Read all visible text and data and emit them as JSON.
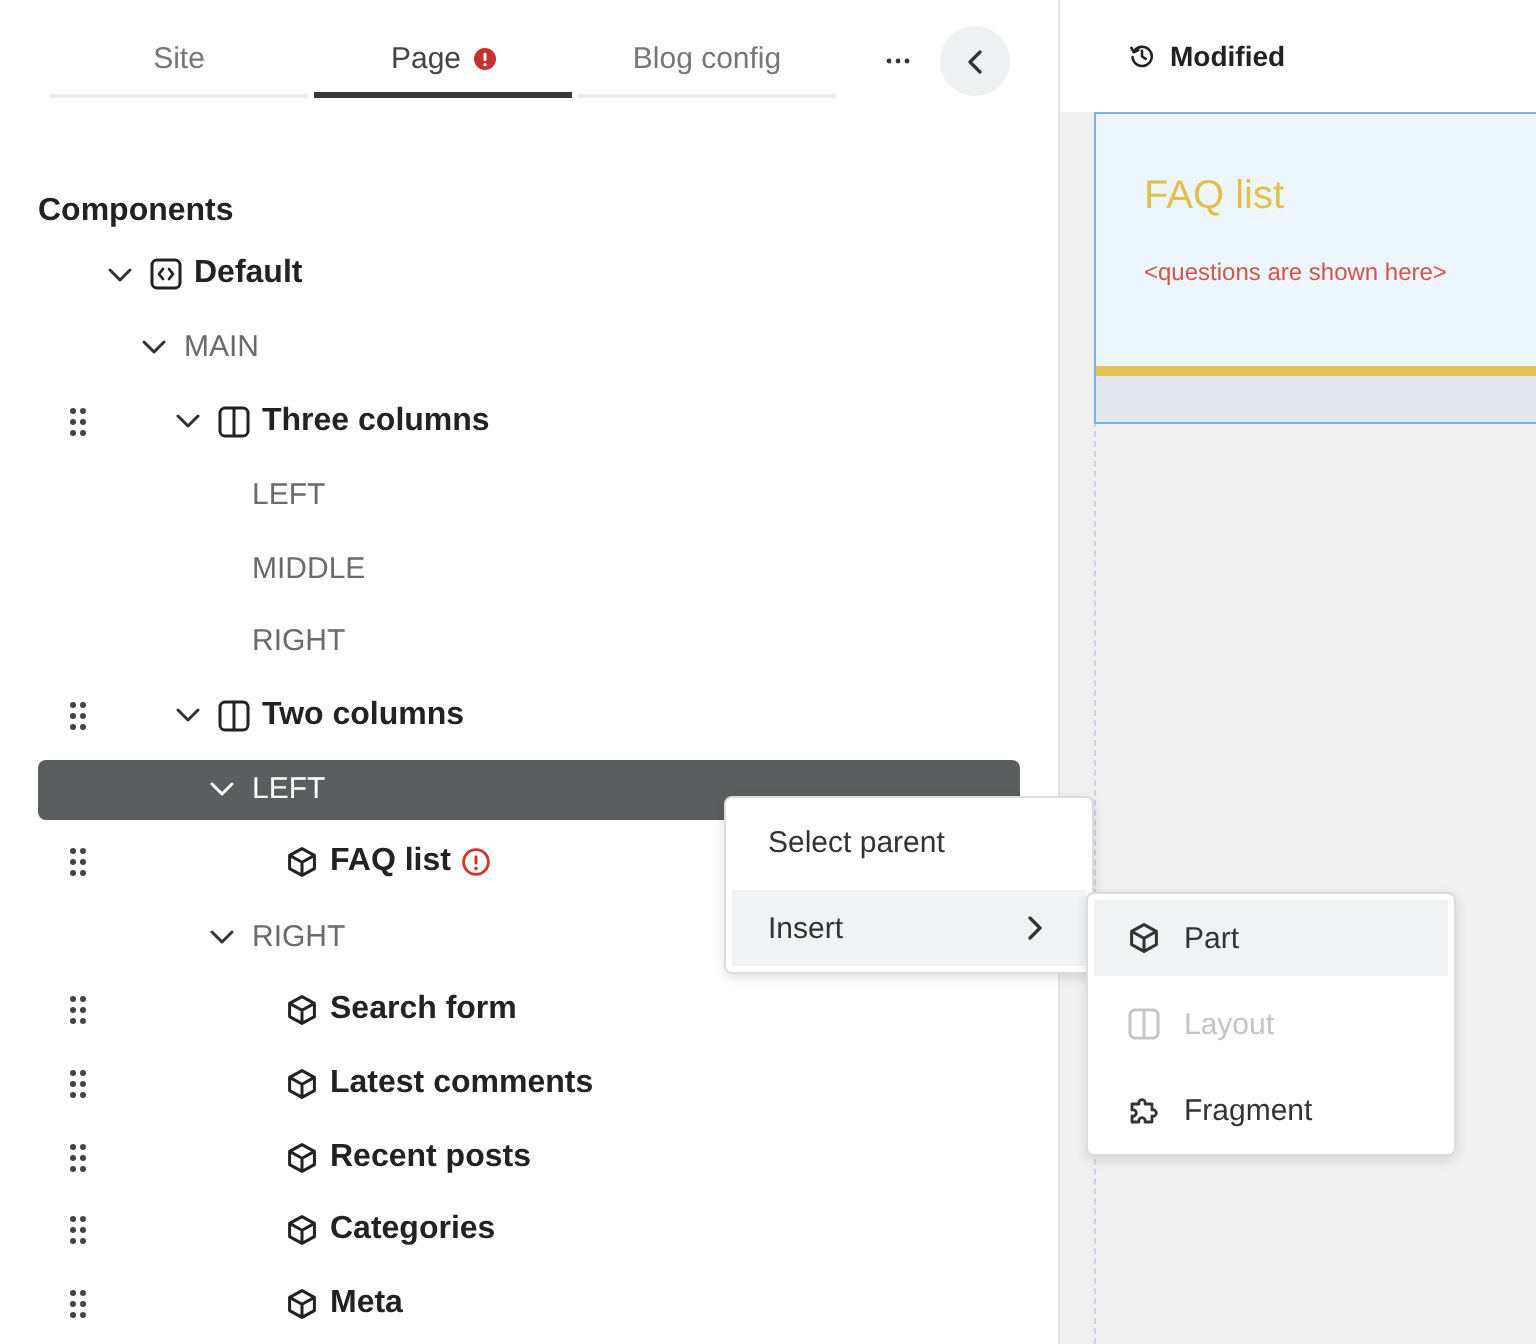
{
  "tabs": [
    {
      "label": "Site",
      "selected": false,
      "error": false
    },
    {
      "label": "Page",
      "selected": true,
      "error": true
    },
    {
      "label": "Blog config",
      "selected": false,
      "error": false
    }
  ],
  "components": {
    "title": "Components",
    "tree": [
      {
        "kind": "page",
        "label": "Default",
        "draggable": false,
        "selected": false,
        "error": false,
        "expanded": true,
        "children": [
          {
            "kind": "region",
            "label": "MAIN",
            "draggable": false,
            "selected": false,
            "error": false,
            "expanded": true,
            "children": [
              {
                "kind": "layout",
                "label": "Three columns",
                "draggable": true,
                "selected": false,
                "error": false,
                "expanded": true,
                "children": [
                  {
                    "kind": "region",
                    "label": "LEFT",
                    "draggable": false,
                    "selected": false,
                    "error": false
                  },
                  {
                    "kind": "region",
                    "label": "MIDDLE",
                    "draggable": false,
                    "selected": false,
                    "error": false
                  },
                  {
                    "kind": "region",
                    "label": "RIGHT",
                    "draggable": false,
                    "selected": false,
                    "error": false
                  }
                ]
              },
              {
                "kind": "layout",
                "label": "Two columns",
                "draggable": true,
                "selected": false,
                "error": false,
                "expanded": true,
                "children": [
                  {
                    "kind": "region",
                    "label": "LEFT",
                    "draggable": false,
                    "selected": true,
                    "error": false,
                    "expanded": true,
                    "children": [
                      {
                        "kind": "part",
                        "label": "FAQ list",
                        "draggable": true,
                        "selected": false,
                        "error": true
                      }
                    ]
                  },
                  {
                    "kind": "region",
                    "label": "RIGHT",
                    "draggable": false,
                    "selected": false,
                    "error": false,
                    "expanded": true,
                    "children": [
                      {
                        "kind": "part",
                        "label": "Search form",
                        "draggable": true,
                        "selected": false,
                        "error": false
                      },
                      {
                        "kind": "part",
                        "label": "Latest comments",
                        "draggable": true,
                        "selected": false,
                        "error": false
                      },
                      {
                        "kind": "part",
                        "label": "Recent posts",
                        "draggable": true,
                        "selected": false,
                        "error": false
                      },
                      {
                        "kind": "part",
                        "label": "Categories",
                        "draggable": true,
                        "selected": false,
                        "error": false
                      },
                      {
                        "kind": "part",
                        "label": "Meta",
                        "draggable": true,
                        "selected": false,
                        "error": false
                      }
                    ]
                  }
                ]
              }
            ]
          }
        ]
      }
    ]
  },
  "status": {
    "label": "Modified"
  },
  "preview": {
    "title": "FAQ list",
    "note": "<questions are shown here>"
  },
  "context_menu": {
    "items": [
      {
        "label": "Select parent",
        "highlighted": false,
        "submenu": false
      },
      {
        "label": "Insert",
        "highlighted": true,
        "submenu": true
      }
    ],
    "submenu": {
      "items": [
        {
          "kind": "part",
          "label": "Part",
          "highlighted": true,
          "disabled": false
        },
        {
          "kind": "layout",
          "label": "Layout",
          "highlighted": false,
          "disabled": true
        },
        {
          "kind": "fragment",
          "label": "Fragment",
          "highlighted": false,
          "disabled": false
        }
      ]
    }
  }
}
